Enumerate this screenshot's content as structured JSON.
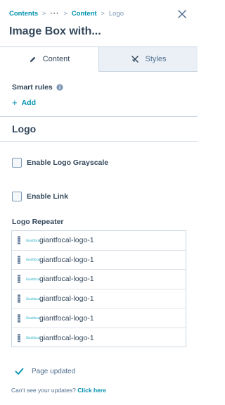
{
  "breadcrumb": {
    "items": [
      "Contents",
      "···",
      "Content",
      "Logo"
    ],
    "separator": ">"
  },
  "header": {
    "title": "Image Box with..."
  },
  "tabs": [
    {
      "label": "Content",
      "icon": "pencil-icon",
      "active": true
    },
    {
      "label": "Styles",
      "icon": "palette-icon",
      "active": false
    }
  ],
  "smart_rules": {
    "label": "Smart rules",
    "add_label": "Add"
  },
  "section": {
    "title": "Logo"
  },
  "options": [
    {
      "label": "Enable Logo Grayscale",
      "checked": false
    },
    {
      "label": "Enable Link",
      "checked": false
    }
  ],
  "repeater": {
    "label": "Logo Repeater",
    "thumb_text": "Giantfocal",
    "items": [
      "giantfocal-logo-1",
      "giantfocal-logo-1",
      "giantfocal-logo-1",
      "giantfocal-logo-1",
      "giantfocal-logo-1",
      "giantfocal-logo-1"
    ]
  },
  "status": {
    "text": "Page updated",
    "help_text": "Can't see your updates?",
    "help_link": "Click here"
  },
  "colors": {
    "accent": "#0091ae",
    "text": "#33475b",
    "border": "#cbd6e2",
    "tab_inactive": "#eaf0f6"
  }
}
